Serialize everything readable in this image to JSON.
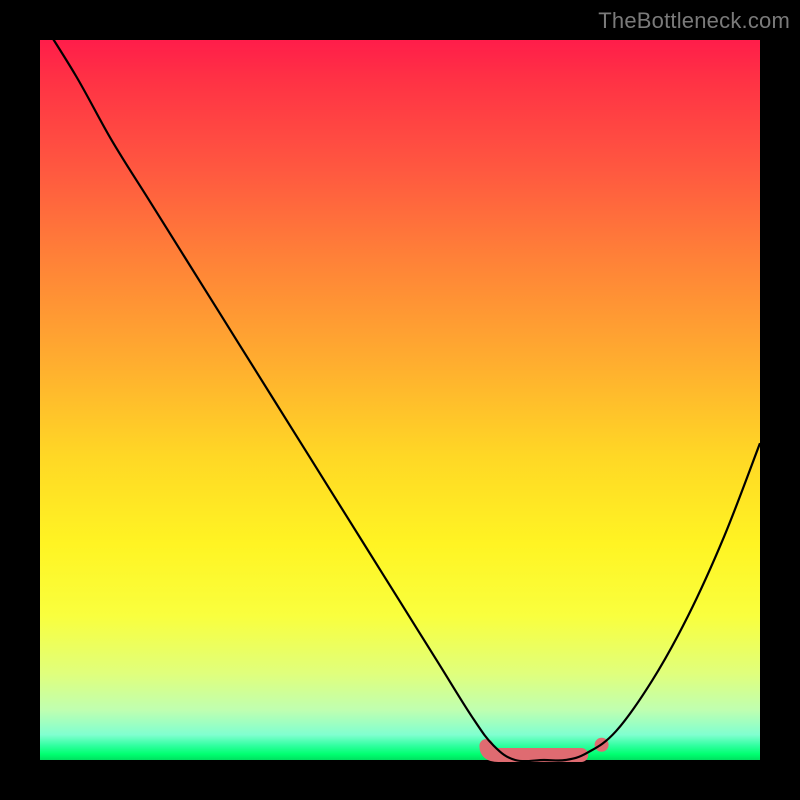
{
  "watermark": "TheBottleneck.com",
  "colors": {
    "gradient_top": "#ff1d4a",
    "gradient_mid": "#ffd825",
    "gradient_bottom": "#00e060",
    "curve": "#000000",
    "marker": "#df6b71",
    "frame_bg": "#000000"
  },
  "chart_data": {
    "type": "line",
    "title": "",
    "xlabel": "",
    "ylabel": "",
    "xlim": [
      0,
      100
    ],
    "ylim": [
      0,
      100
    ],
    "grid": false,
    "series": [
      {
        "name": "bottleneck-curve",
        "x": [
          0,
          5,
          10,
          15,
          20,
          25,
          30,
          35,
          40,
          45,
          50,
          55,
          60,
          63,
          66,
          70,
          73,
          76,
          80,
          85,
          90,
          95,
          100
        ],
        "y": [
          103,
          95,
          86,
          78,
          70,
          62,
          54,
          46,
          38,
          30,
          22,
          14,
          6,
          2,
          0,
          0,
          0,
          1,
          4,
          11,
          20,
          31,
          44
        ]
      }
    ],
    "marker": {
      "name": "optimal-range",
      "x_start": 62,
      "x_end": 76,
      "y": 0,
      "dot_x": 78,
      "dot_y": 1
    },
    "annotations": []
  }
}
